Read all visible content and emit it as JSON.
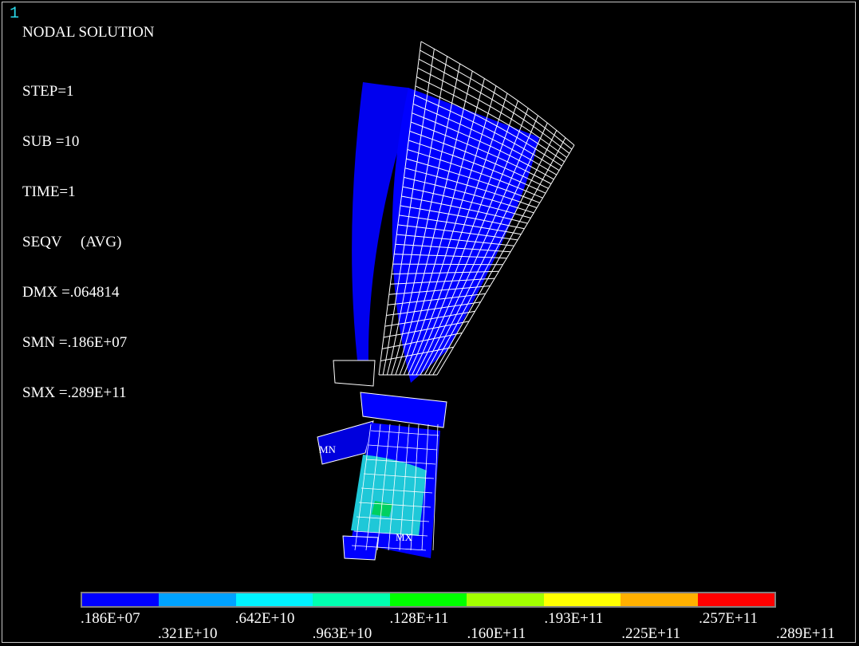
{
  "window_number": "1",
  "title": "NODAL SOLUTION",
  "info_lines": [
    "STEP=1",
    "SUB =10",
    "TIME=1",
    "SEQV     (AVG)",
    "DMX =.064814",
    "SMN =.186E+07",
    "SMX =.289E+11"
  ],
  "markers": {
    "min": "MN",
    "max": "MX"
  },
  "legend": {
    "colors": [
      "#0000ff",
      "#00a2ff",
      "#00f2ff",
      "#00ffb0",
      "#00ff00",
      "#a2ff00",
      "#ffff00",
      "#ffb000",
      "#ff0000"
    ],
    "upper_labels": [
      ".186E+07",
      ".642E+10",
      ".128E+11",
      ".193E+11",
      ".257E+11"
    ],
    "lower_labels": [
      ".321E+10",
      ".963E+10",
      ".160E+11",
      ".225E+11",
      ".289E+11"
    ]
  },
  "colors": {
    "background": "#000000",
    "mesh": "#ffffff",
    "window_number": "#2ad7e8"
  }
}
